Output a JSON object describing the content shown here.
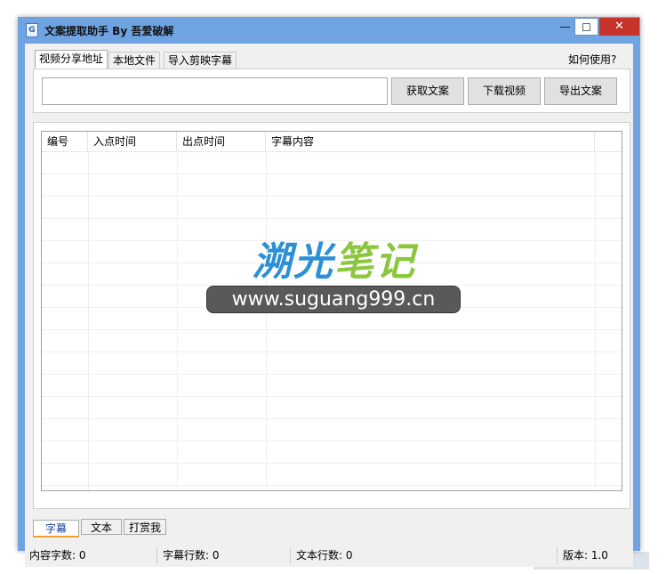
{
  "window": {
    "title": "文案提取助手 By 吾爱破解",
    "icon_name": "app-icon",
    "icon_glyph": "G",
    "minimize_symbol": "—",
    "maximize_symbol": "☐",
    "close_symbol": "✕"
  },
  "top_tabs": [
    {
      "label": "视频分享地址",
      "active": true
    },
    {
      "label": "本地文件",
      "active": false
    },
    {
      "label": "导入剪映字幕",
      "active": false
    }
  ],
  "help_link": "如何使用?",
  "url_input": {
    "value": "",
    "placeholder": ""
  },
  "buttons": {
    "fetch": "获取文案",
    "download": "下载视频",
    "export": "导出文案"
  },
  "table": {
    "columns": [
      "编号",
      "入点时间",
      "出点时间",
      "字幕内容"
    ],
    "rows": []
  },
  "watermark": {
    "title_part1": "溯光",
    "title_part2": "笔记",
    "url": "www.suguang999.cn"
  },
  "bottom_tabs": [
    {
      "label": "字幕",
      "active": true
    },
    {
      "label": "文本",
      "active": false
    },
    {
      "label": "打赏我",
      "active": false
    }
  ],
  "status": {
    "content_chars": "内容字数: 0",
    "subtitle_lines": "字幕行数: 0",
    "text_lines": "文本行数: 0",
    "version": "版本: 1.0"
  },
  "colors": {
    "frame": "#6fa3e2",
    "close_button": "#c7332b",
    "watermark_blue": "#2d8fd5",
    "watermark_green": "#8cc63f"
  }
}
